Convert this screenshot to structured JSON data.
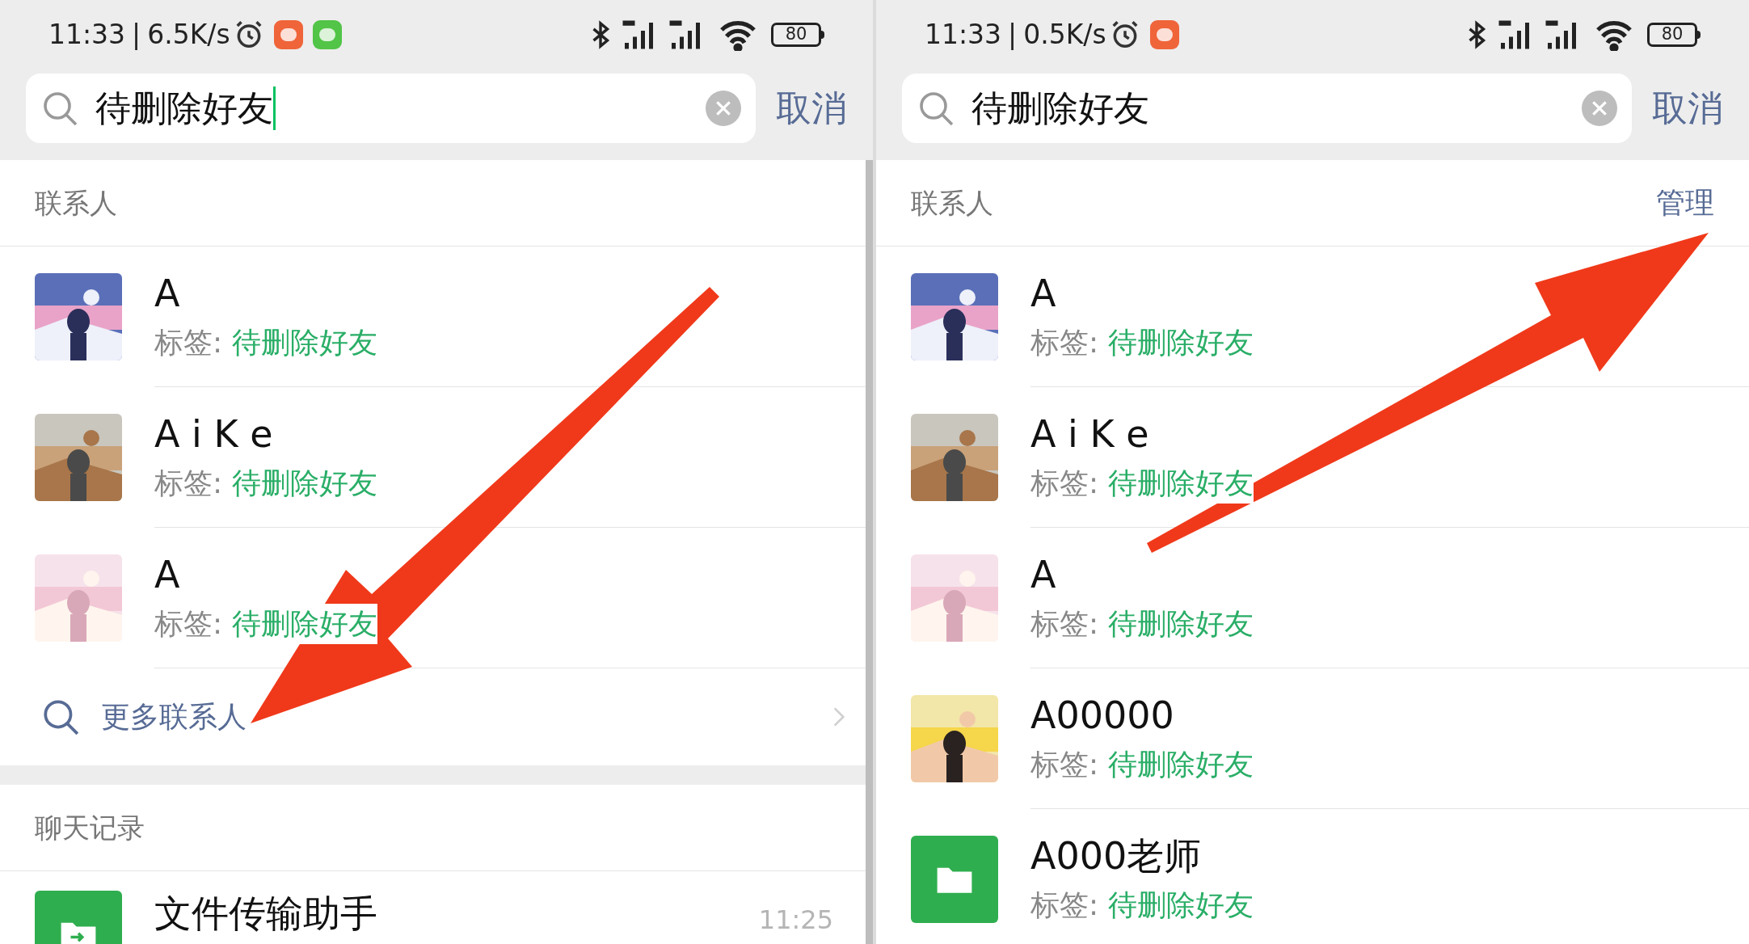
{
  "panels": [
    {
      "status_bar": {
        "time": "11:33",
        "separator": "|",
        "speed": "6.5K/s",
        "app_icons": [
          {
            "color": "#f0643a"
          },
          {
            "color": "#52c447"
          }
        ],
        "battery": "80"
      },
      "search": {
        "value": "待删除好友",
        "focused": true
      },
      "cancel": "取消",
      "contacts_header": "联系人",
      "contacts": [
        {
          "name": "A",
          "tag_label": "标签: ",
          "tag": "待删除好友",
          "avatar": {
            "kind": "snow"
          }
        },
        {
          "name": "A i K e",
          "tag_label": "标签: ",
          "tag": "待删除好友",
          "avatar": {
            "kind": "desert"
          }
        },
        {
          "name": "A",
          "tag_label": "标签: ",
          "tag": "待删除好友",
          "avatar": {
            "kind": "pink"
          }
        }
      ],
      "more_contacts": "更多联系人",
      "chat_header": "聊天记录",
      "chats": [
        {
          "name": "文件传输助手",
          "time": "11:25"
        }
      ],
      "arrow": {
        "kind": "down"
      }
    },
    {
      "status_bar": {
        "time": "11:33",
        "separator": "|",
        "speed": "0.5K/s",
        "app_icons": [
          {
            "color": "#f0643a"
          }
        ],
        "battery": "80"
      },
      "search": {
        "value": "待删除好友",
        "focused": false
      },
      "cancel": "取消",
      "contacts_header": "联系人",
      "manage": "管理",
      "contacts": [
        {
          "name": "A",
          "tag_label": "标签: ",
          "tag": "待删除好友",
          "avatar": {
            "kind": "snow"
          }
        },
        {
          "name": "A i K e",
          "tag_label": "标签: ",
          "tag": "待删除好友",
          "avatar": {
            "kind": "desert"
          }
        },
        {
          "name": "A",
          "tag_label": "标签: ",
          "tag": "待删除好友",
          "avatar": {
            "kind": "pink"
          }
        },
        {
          "name": "A00000",
          "tag_label": "标签: ",
          "tag": "待删除好友",
          "avatar": {
            "kind": "yellow"
          }
        },
        {
          "name": "A000老师",
          "tag_label": "标签: ",
          "tag": "待删除好友",
          "avatar": {
            "kind": "folder"
          }
        }
      ],
      "arrow": {
        "kind": "up"
      }
    }
  ]
}
